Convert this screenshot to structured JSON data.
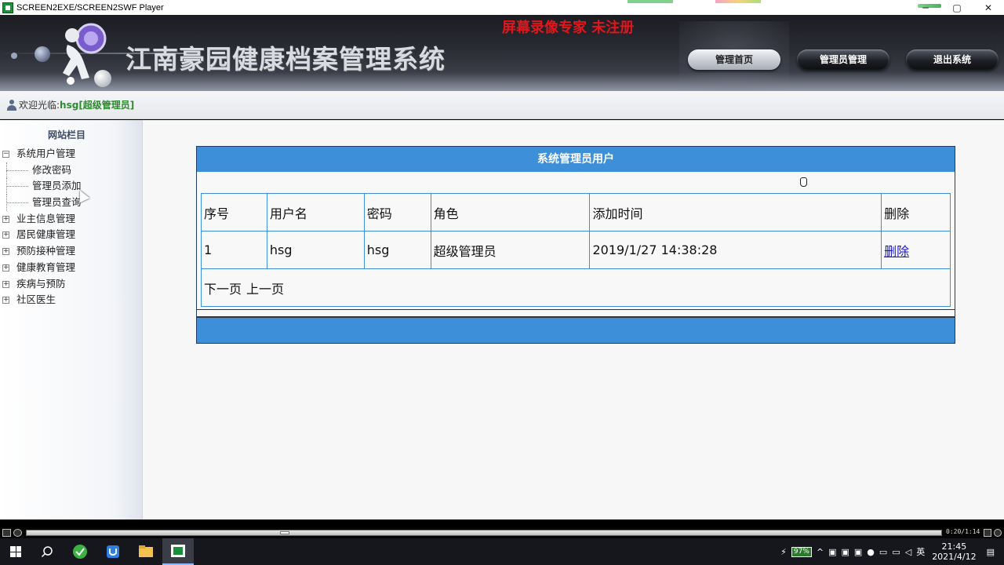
{
  "window": {
    "title": "SCREEN2EXE/SCREEN2SWF Player",
    "controls": [
      "─",
      "▢",
      "✕"
    ]
  },
  "header": {
    "system_title": "江南豪园健康档案管理系统",
    "watermark": "屏幕录像专家  未注册",
    "nav": [
      {
        "label": "管理首页",
        "active": true
      },
      {
        "label": "管理员管理",
        "active": false
      },
      {
        "label": "退出系统",
        "active": false
      }
    ]
  },
  "welcome": {
    "label": "欢迎光临:",
    "username": "hsg[超级管理员]"
  },
  "sidebar": {
    "title": "网站栏目",
    "tree": [
      {
        "label": "系统用户管理",
        "expanded": true,
        "children": [
          "修改密码",
          "管理员添加",
          "管理员查询"
        ]
      },
      {
        "label": "业主信息管理",
        "expanded": false
      },
      {
        "label": "居民健康管理",
        "expanded": false
      },
      {
        "label": "预防接种管理",
        "expanded": false
      },
      {
        "label": "健康教育管理",
        "expanded": false
      },
      {
        "label": "疾病与预防",
        "expanded": false
      },
      {
        "label": "社区医生",
        "expanded": false
      }
    ]
  },
  "main": {
    "panel_title": "系统管理员用户",
    "columns": [
      "序号",
      "用户名",
      "密码",
      "角色",
      "添加时间",
      "删除"
    ],
    "rows": [
      {
        "id": "1",
        "username": "hsg",
        "password": "hsg",
        "role": "超级管理员",
        "added": "2019/1/27 14:38:28",
        "action": "删除"
      }
    ],
    "pager": {
      "next": "下一页",
      "prev": "上一页"
    }
  },
  "player": {
    "time": "0:20/1:14",
    "progress_fraction": 0.28
  },
  "taskbar": {
    "battery": "97%",
    "ime": "英",
    "time": "21:45",
    "date": "2021/4/12"
  },
  "colors": {
    "accent_blue": "#3d8fd9",
    "link": "#1b17c8",
    "watermark_red": "#e0161b",
    "username_green": "#2f8a2f"
  }
}
